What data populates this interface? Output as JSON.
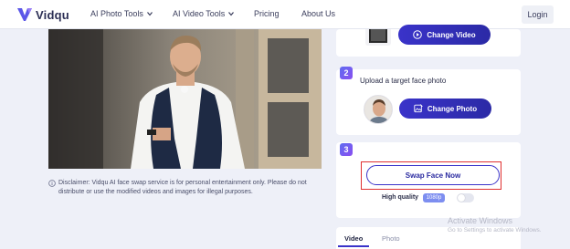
{
  "brand": {
    "name": "Vidqu",
    "accent": "#3a33c9",
    "gradient": [
      "#5f6cf0",
      "#8a4ff0"
    ]
  },
  "nav": {
    "items": [
      {
        "label": "AI Photo Tools",
        "has_dropdown": true
      },
      {
        "label": "AI Video Tools",
        "has_dropdown": true
      },
      {
        "label": "Pricing",
        "has_dropdown": false
      },
      {
        "label": "About Us",
        "has_dropdown": false
      }
    ],
    "login_label": "Login"
  },
  "preview": {
    "icon": "video-preview-image"
  },
  "disclaimer": {
    "icon": "info-icon",
    "text": "Disclaimer: Vidqu AI face swap service is for personal entertainment only. Please do not distribute or use the modified videos and images for illegal purposes."
  },
  "steps": {
    "step1": {
      "button_label": "Change Video",
      "button_icon": "play-icon"
    },
    "step2": {
      "number": "2",
      "label": "Upload a target face photo",
      "button_label": "Change Photo",
      "button_icon": "image-edit-icon"
    },
    "step3": {
      "number": "3",
      "button_label": "Swap Face Now",
      "highlight_color": "#e03030"
    }
  },
  "quality": {
    "label": "High quality",
    "badge": "1080p",
    "toggle_on": false
  },
  "tabs": [
    {
      "label": "Video",
      "active": true
    },
    {
      "label": "Photo",
      "active": false
    }
  ],
  "os_watermark": {
    "title": "Activate Windows",
    "subtitle": "Go to Settings to activate Windows."
  }
}
